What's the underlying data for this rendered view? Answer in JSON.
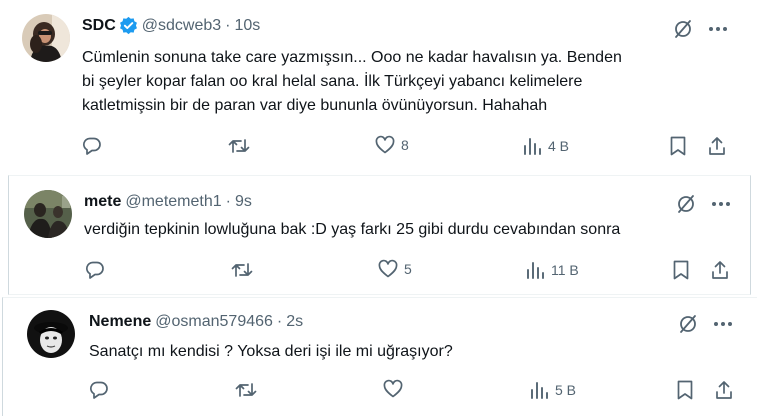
{
  "tweets": [
    {
      "name": "SDC",
      "handle": "@sdcweb3",
      "time": "10s",
      "verified": true,
      "lines": [
        "Cümlenin sonuna take care yazmışsın... Ooo ne kadar havalısın ya. Benden",
        "bi şeyler kopar falan oo kral helal sana. İlk Türkçeyi yabancı kelimelere",
        "katletmişsin bir de paran var diye bununla övünüyorsun. Hahahah"
      ],
      "likes": "8",
      "views": "4 B"
    },
    {
      "name": "mete",
      "handle": "@metemeth1",
      "time": "9s",
      "verified": false,
      "lines": [
        "verdiğin tepkinin lowluğuna bak :D yaş farkı 25 gibi durdu cevabından sonra"
      ],
      "likes": "5",
      "views": "11 B"
    },
    {
      "name": "Nemene",
      "handle": "@osman579466",
      "time": "2s",
      "verified": false,
      "lines": [
        "Sanatçı mı kendisi ? Yoksa deri işi ile mi uğraşıyor?"
      ],
      "likes": "",
      "views": "5 B"
    }
  ],
  "separator": "·",
  "colors": {
    "verified": "#1d9bf0",
    "icon": "#536471",
    "text": "#0f1419"
  },
  "icons": [
    "reply-icon",
    "retweet-icon",
    "like-icon",
    "views-icon",
    "bookmark-icon",
    "share-icon",
    "grok-icon",
    "more-icon"
  ]
}
